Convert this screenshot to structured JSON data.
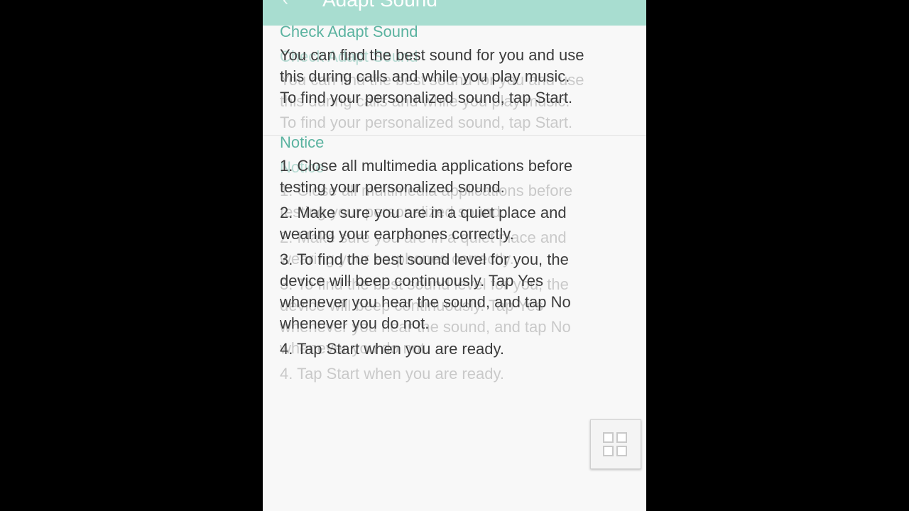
{
  "appbar": {
    "title": "Adapt Sound",
    "back_icon": "arrow-left-icon"
  },
  "check_section": {
    "title": "Check Adapt Sound",
    "lines": [
      "You can find the best sound for you and use",
      "this during calls and while you play music.",
      "To find your personalized sound, tap Start."
    ]
  },
  "notice_section": {
    "title": "Notice",
    "items": [
      [
        "1. Close all multimedia applications before",
        "testing your personalized sound."
      ],
      [
        "2. Make sure you are in a quiet place and",
        "wearing your earphones correctly."
      ],
      [
        "3. To find the best sound level for you, the",
        "device will beep continuously. Tap Yes",
        "whenever you hear the sound, and tap No",
        "whenever you do not."
      ],
      [
        "4. Tap Start when you are ready."
      ]
    ]
  },
  "floating_button": {
    "icon": "grid-icon"
  },
  "colors": {
    "accent": "#5bb3a0",
    "appbar": "#a8ddd0",
    "background": "#f8f8f8"
  }
}
